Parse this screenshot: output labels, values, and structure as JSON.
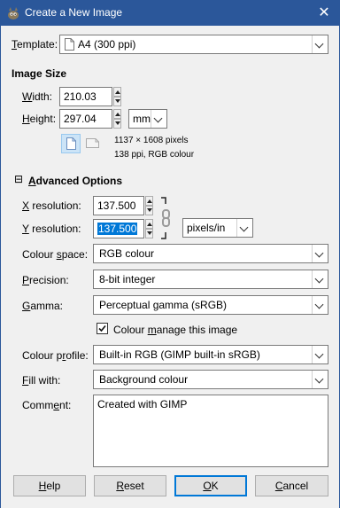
{
  "window": {
    "title": "Create a New Image"
  },
  "template": {
    "label_u": "T",
    "label_rest": "emplate:",
    "value": "A4 (300 ppi)"
  },
  "image_size": {
    "heading": "Image Size",
    "width_label_u": "W",
    "width_label_rest": "idth:",
    "width_value": "210.03",
    "height_label_u": "H",
    "height_label_rest": "eight:",
    "height_value": "297.04",
    "unit": "mm",
    "pixels_info": "1137 × 1608 pixels",
    "res_info": "138 ppi, RGB colour"
  },
  "advanced": {
    "expander_symbol": "⊟",
    "heading_u": "A",
    "heading_rest": "dvanced Options",
    "xres_label_u": "X",
    "xres_label_rest": " resolution:",
    "xres_value": "137.500",
    "yres_label_u": "Y",
    "yres_label_rest": " resolution:",
    "yres_value": "137.500",
    "res_unit": "pixels/in",
    "colour_space_pre": "Colour ",
    "colour_space_u": "s",
    "colour_space_post": "pace:",
    "colour_space_value": "RGB colour",
    "precision_u": "P",
    "precision_rest": "recision:",
    "precision_value": "8-bit integer",
    "gamma_u": "G",
    "gamma_rest": "amma:",
    "gamma_value": "Perceptual gamma (sRGB)",
    "manage_pre": "Colour ",
    "manage_u": "m",
    "manage_post": "anage this image",
    "manage_checked": true,
    "profile_pre": "Colour p",
    "profile_u": "r",
    "profile_post": "ofile:",
    "profile_value": "Built-in RGB (GIMP built-in sRGB)",
    "fill_u": "F",
    "fill_rest": "ill with:",
    "fill_value": "Background colour",
    "comment_pre": "Comm",
    "comment_u": "e",
    "comment_post": "nt:",
    "comment_value": "Created with GIMP"
  },
  "buttons": {
    "help_u": "H",
    "help_rest": "elp",
    "reset_u": "R",
    "reset_rest": "eset",
    "ok_u": "O",
    "ok_rest": "K",
    "cancel_u": "C",
    "cancel_rest": "ancel"
  },
  "icons": {
    "app": "gimp-wilber-icon",
    "close": "close-icon",
    "template": "document-icon",
    "portrait": "portrait-orientation-icon",
    "landscape": "landscape-orientation-icon",
    "chain": "chain-link-icon",
    "check": "checkmark-icon"
  },
  "colors": {
    "titlebar": "#2b579a",
    "accent": "#0078d7",
    "dialog_bg": "#f0f0f0"
  }
}
